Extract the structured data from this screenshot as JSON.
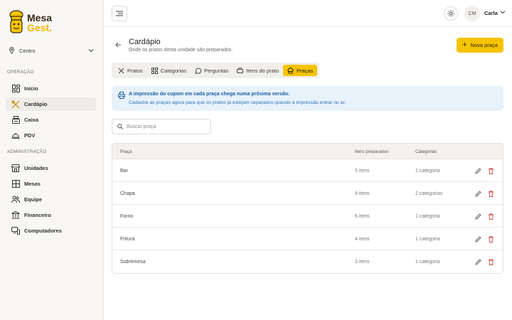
{
  "brand": {
    "line1": "Mesa",
    "line2": "Gest."
  },
  "unit_selector": {
    "value": "Centro"
  },
  "sidebar": {
    "section_operation": "OPERAÇÃO",
    "section_admin": "ADMINISTRAÇÃO",
    "operation_items": [
      {
        "label": "Início",
        "icon": "grid-icon"
      },
      {
        "label": "Cardápio",
        "icon": "utensils-icon",
        "active": true
      },
      {
        "label": "Caixa",
        "icon": "cash-register-icon"
      },
      {
        "label": "PDV",
        "icon": "bell-tray-icon"
      }
    ],
    "admin_items": [
      {
        "label": "Unidades",
        "icon": "store-icon"
      },
      {
        "label": "Mesas",
        "icon": "table-grid-icon"
      },
      {
        "label": "Equipe",
        "icon": "users-icon"
      },
      {
        "label": "Financeiro",
        "icon": "bank-icon"
      },
      {
        "label": "Computadores",
        "icon": "devices-icon"
      }
    ]
  },
  "topbar": {
    "avatar_initials": "CM",
    "user_name": "Carla"
  },
  "page": {
    "title": "Cardápio",
    "subtitle": "Onde os pratos desta unidade são preparados.",
    "primary_button": "Nova praça"
  },
  "tabs": [
    {
      "label": "Pratos",
      "icon": "utensils-icon"
    },
    {
      "label": "Categorias",
      "icon": "grid-icon"
    },
    {
      "label": "Perguntas",
      "icon": "chat-icon"
    },
    {
      "label": "Itens do prato",
      "icon": "tag-icon"
    },
    {
      "label": "Praças",
      "icon": "chef-hat-icon",
      "active": true
    }
  ],
  "info": {
    "title": "A impressão do cupom em cada praça chega numa próxima versão.",
    "text": "Cadastre as praças agora para que os pratos já estejam separados quando a impressão entrar no ar."
  },
  "search": {
    "placeholder": "Buscar praça"
  },
  "table": {
    "headers": {
      "name": "Praça",
      "items": "Itens preparados",
      "categories": "Categorias"
    },
    "rows": [
      {
        "name": "Bar",
        "items": "5 itens",
        "categories": "1 categoria"
      },
      {
        "name": "Chapa",
        "items": "8 itens",
        "categories": "2 categorias"
      },
      {
        "name": "Forno",
        "items": "6 itens",
        "categories": "1 categoria"
      },
      {
        "name": "Fritura",
        "items": "4 itens",
        "categories": "1 categoria"
      },
      {
        "name": "Sobremesa",
        "items": "3 itens",
        "categories": "1 categoria"
      }
    ]
  },
  "colors": {
    "accent": "#f5c400",
    "info_bg": "#e7f2fb",
    "info_text": "#1f5fa3",
    "delete": "#d64040"
  }
}
